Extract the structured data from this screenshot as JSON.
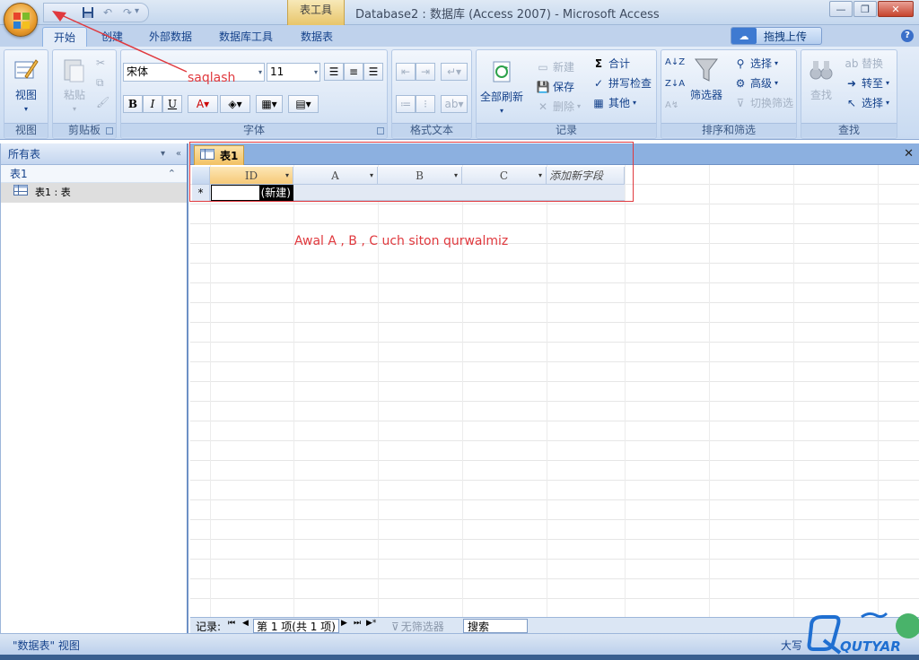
{
  "window": {
    "title": "Database2 : 数据库 (Access 2007) - Microsoft Access",
    "context_tab": "表工具"
  },
  "ribbon_tabs": [
    "开始",
    "创建",
    "外部数据",
    "数据库工具",
    "数据表"
  ],
  "drag_upload_label": "拖拽上传",
  "groups": {
    "view": {
      "label": "视图",
      "button": "视图"
    },
    "clipboard": {
      "label": "剪贴板",
      "paste": "粘贴"
    },
    "font": {
      "label": "字体",
      "font_name": "宋体",
      "font_size": "11"
    },
    "rich_text": {
      "label": "格式文本"
    },
    "records": {
      "label": "记录",
      "refresh_all": "全部刷新",
      "new": "新建",
      "save": "保存",
      "delete": "删除",
      "totals": "合计",
      "spelling": "拼写检查",
      "more": "其他"
    },
    "sort_filter": {
      "label": "排序和筛选",
      "filter": "筛选器",
      "selection": "选择",
      "advanced": "高级",
      "toggle_filter": "切换筛选"
    },
    "find": {
      "label": "查找",
      "find": "查找",
      "replace": "替换",
      "goto": "转至",
      "select": "选择"
    }
  },
  "nav_pane": {
    "header": "所有表",
    "group": "表1",
    "items": [
      "表1 : 表"
    ]
  },
  "document": {
    "tab_label": "表1",
    "columns": [
      "ID",
      "A",
      "B",
      "C",
      "添加新字段"
    ],
    "new_row_marker": "*",
    "new_row_value": "(新建)"
  },
  "annotations": {
    "arrow_label": "saqlash",
    "note": "Awal  A , B , C  uch  siton   qurwalmiz"
  },
  "record_bar": {
    "label": "记录:",
    "position": "第 1 项(共 1 项)",
    "filter": "无筛选器",
    "search": "搜索"
  },
  "status": {
    "view_name": "\"数据表\" 视图",
    "caps": "大写"
  },
  "watermark": "QUTYAR",
  "colors": {
    "annotation_red": "#e0393e",
    "ribbon_blue": "#c8daf1"
  }
}
